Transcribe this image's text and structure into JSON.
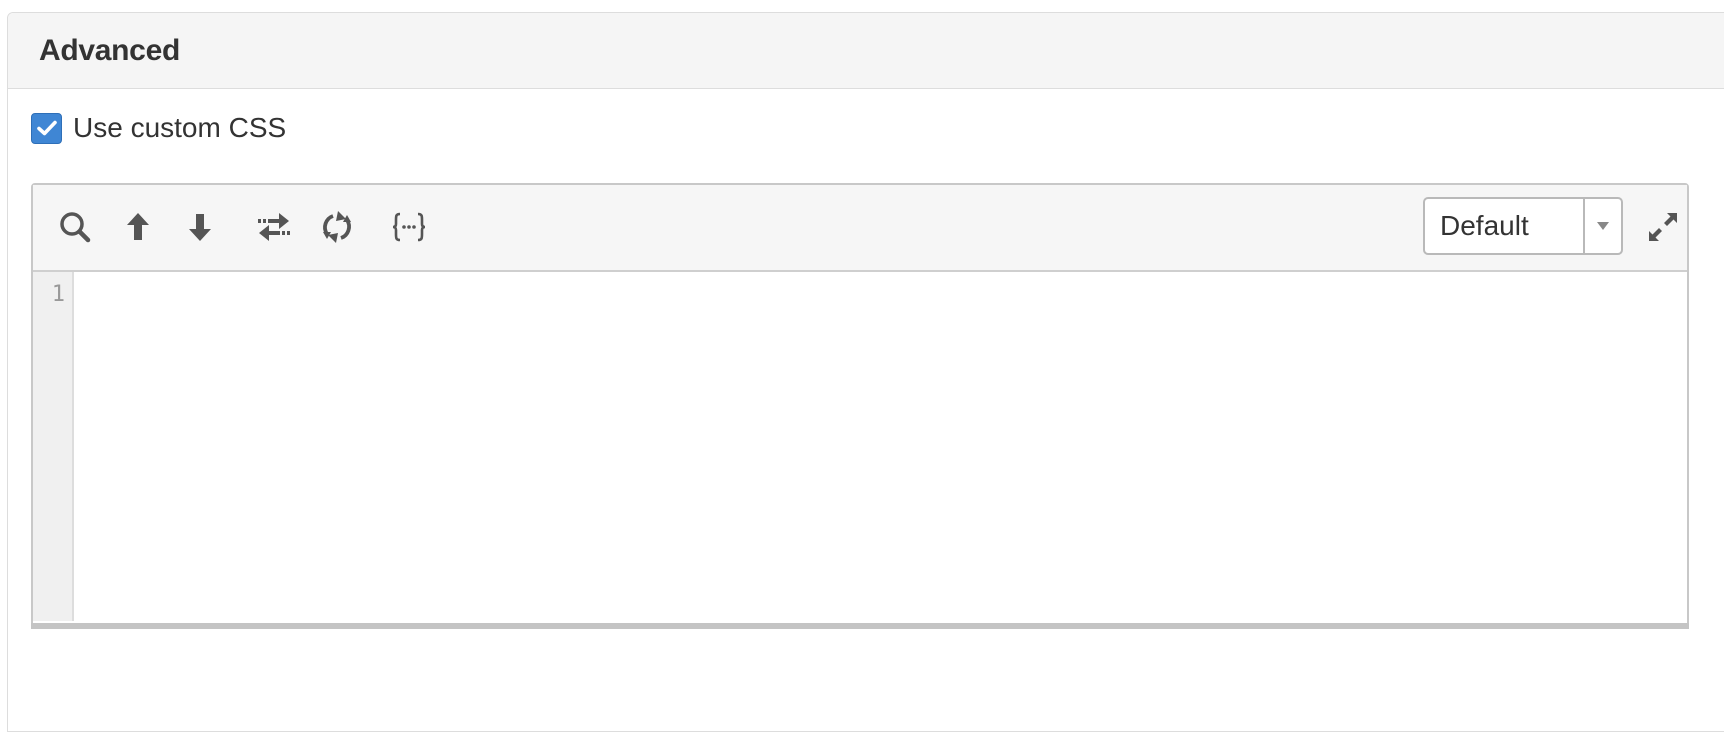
{
  "panel": {
    "title": "Advanced"
  },
  "custom_css": {
    "checked": true,
    "label": "Use custom CSS"
  },
  "editor": {
    "toolbar": {
      "buttons": [
        "search-icon",
        "arrow-up-icon",
        "arrow-down-icon",
        "swap-icon",
        "refresh-icon",
        "code-braces-icon"
      ],
      "theme_select": {
        "value": "Default"
      },
      "fullscreen_icon": "expand-icon"
    },
    "lines": [
      {
        "number": "1",
        "text": ""
      }
    ]
  },
  "colors": {
    "checkbox_accent": "#3f86d4",
    "icon": "#555555"
  }
}
